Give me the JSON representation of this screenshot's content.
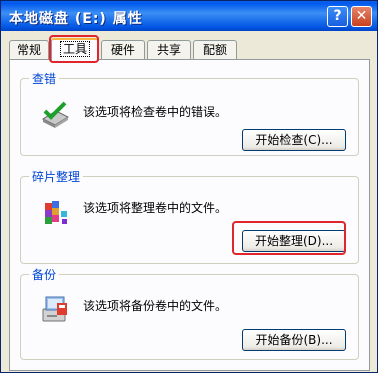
{
  "window": {
    "title": "本地磁盘 (E:) 属性",
    "help_button": "?",
    "close_button": "✕"
  },
  "tabs": [
    {
      "label": "常规",
      "active": false
    },
    {
      "label": "工具",
      "active": true
    },
    {
      "label": "硬件",
      "active": false
    },
    {
      "label": "共享",
      "active": false
    },
    {
      "label": "配额",
      "active": false
    }
  ],
  "groups": {
    "check": {
      "title": "查错",
      "description": "该选项将检查卷中的错误。",
      "button": "开始检查(C)...",
      "icon": "check-disk-icon"
    },
    "defrag": {
      "title": "碎片整理",
      "description": "该选项将整理卷中的文件。",
      "button": "开始整理(D)...",
      "icon": "defrag-icon"
    },
    "backup": {
      "title": "备份",
      "description": "该选项将备份卷中的文件。",
      "button": "开始备份(B)...",
      "icon": "backup-icon"
    }
  },
  "highlight_color": "#E0262D"
}
